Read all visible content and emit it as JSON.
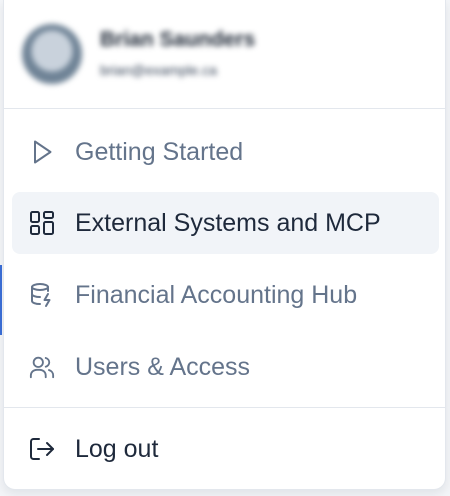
{
  "profile": {
    "name": "Brian Saunders",
    "email": "brian@example.ca"
  },
  "menu": {
    "items": [
      {
        "label": "Getting Started",
        "icon": "play-icon",
        "active": false
      },
      {
        "label": "External Systems and MCP",
        "icon": "grid-icon",
        "active": true
      },
      {
        "label": "Financial Accounting Hub",
        "icon": "database-lightning-icon",
        "active": false
      },
      {
        "label": "Users & Access",
        "icon": "users-icon",
        "active": false
      }
    ],
    "logout": {
      "label": "Log out",
      "icon": "logout-icon"
    }
  },
  "colors": {
    "accent": "#3b6fd8",
    "active_bg": "#f1f4f8",
    "muted_text": "#64748b",
    "dark_text": "#1e293b"
  }
}
